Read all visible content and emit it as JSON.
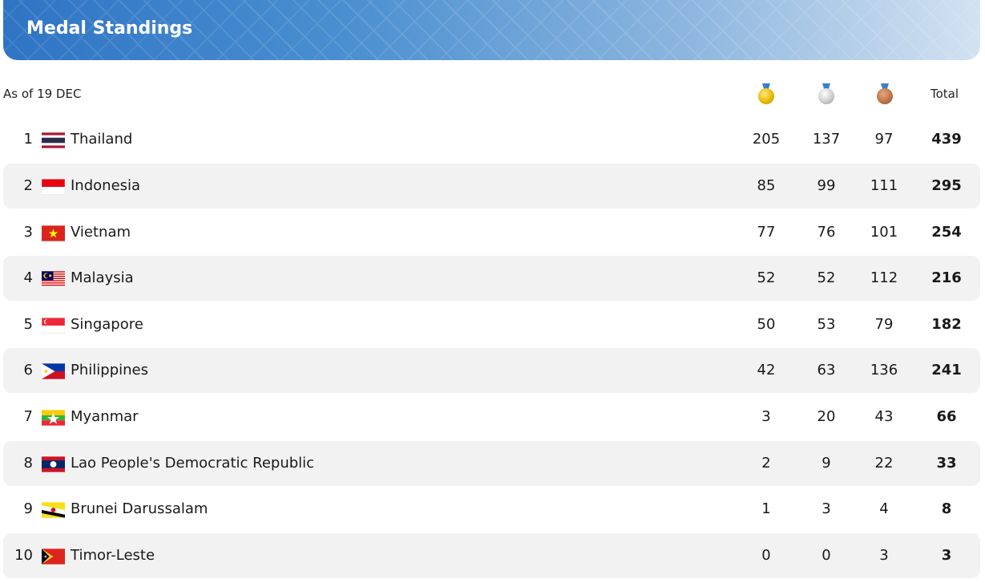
{
  "header": {
    "title": "Medal Standings"
  },
  "as_of": "As of 19 DEC",
  "columns": {
    "gold_icon": "gold-medal-icon",
    "silver_icon": "silver-medal-icon",
    "bronze_icon": "bronze-medal-icon",
    "total": "Total"
  },
  "rows": [
    {
      "rank": "1",
      "country": "Thailand",
      "flag": "flag-thailand-icon",
      "gold": "205",
      "silver": "137",
      "bronze": "97",
      "total": "439"
    },
    {
      "rank": "2",
      "country": "Indonesia",
      "flag": "flag-indonesia-icon",
      "gold": "85",
      "silver": "99",
      "bronze": "111",
      "total": "295"
    },
    {
      "rank": "3",
      "country": "Vietnam",
      "flag": "flag-vietnam-icon",
      "gold": "77",
      "silver": "76",
      "bronze": "101",
      "total": "254"
    },
    {
      "rank": "4",
      "country": "Malaysia",
      "flag": "flag-malaysia-icon",
      "gold": "52",
      "silver": "52",
      "bronze": "112",
      "total": "216"
    },
    {
      "rank": "5",
      "country": "Singapore",
      "flag": "flag-singapore-icon",
      "gold": "50",
      "silver": "53",
      "bronze": "79",
      "total": "182"
    },
    {
      "rank": "6",
      "country": "Philippines",
      "flag": "flag-philippines-icon",
      "gold": "42",
      "silver": "63",
      "bronze": "136",
      "total": "241"
    },
    {
      "rank": "7",
      "country": "Myanmar",
      "flag": "flag-myanmar-icon",
      "gold": "3",
      "silver": "20",
      "bronze": "43",
      "total": "66"
    },
    {
      "rank": "8",
      "country": "Lao People's Democratic Republic",
      "flag": "flag-laos-icon",
      "gold": "2",
      "silver": "9",
      "bronze": "22",
      "total": "33"
    },
    {
      "rank": "9",
      "country": "Brunei Darussalam",
      "flag": "flag-brunei-icon",
      "gold": "1",
      "silver": "3",
      "bronze": "4",
      "total": "8"
    },
    {
      "rank": "10",
      "country": "Timor-Leste",
      "flag": "flag-timor-leste-icon",
      "gold": "0",
      "silver": "0",
      "bronze": "3",
      "total": "3"
    }
  ],
  "colors": {
    "header_start": "#2f74c4",
    "header_end": "#d3e2f1",
    "row_alt": "#f2f2f2",
    "gold": "#e6b400",
    "silver": "#c8c8c8",
    "bronze": "#b8714a"
  }
}
